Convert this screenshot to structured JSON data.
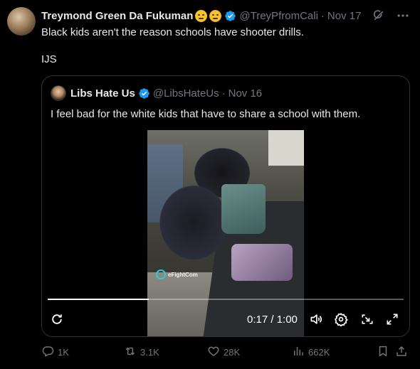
{
  "tweet": {
    "display_name": "Treymond Green Da Fukuman",
    "emojis": [
      "grimace-face-emoji",
      "angry-face-emoji"
    ],
    "handle": "@TreyPfromCali",
    "separator": "·",
    "date": "Nov 17",
    "text_line1": "Black kids aren't the reason schools have shooter drills.",
    "text_line2": "IJS"
  },
  "quote": {
    "display_name": "Libs Hate Us",
    "handle": "@LibsHateUs",
    "separator": "·",
    "date": "Nov 16",
    "text": "I feel bad for the white kids that have to share a school with them.",
    "video": {
      "watermark": "eFightCom",
      "current_time": "0:17",
      "duration": "1:00",
      "time_label": "0:17 / 1:00",
      "progress": 0.283
    }
  },
  "actions": {
    "replies": "1K",
    "reposts": "3.1K",
    "likes": "28K",
    "views": "662K"
  },
  "colors": {
    "background": "#000000",
    "text": "#e7e9ea",
    "muted": "#71767b",
    "border": "#2f3336",
    "verified": "#1d9bf0"
  },
  "icons": [
    "grok-icon",
    "more-icon",
    "verified-icon",
    "replay-icon",
    "volume-icon",
    "settings-icon",
    "pip-icon",
    "fullscreen-icon",
    "reply-icon",
    "repost-icon",
    "like-icon",
    "views-icon",
    "bookmark-icon",
    "share-icon"
  ]
}
